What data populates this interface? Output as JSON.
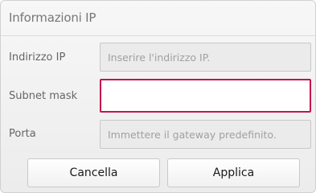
{
  "dialog": {
    "title": "Informazioni IP"
  },
  "fields": [
    {
      "label": "Indirizzo IP",
      "value": "",
      "placeholder": "Inserire l'indirizzo IP."
    },
    {
      "label": "Subnet mask",
      "value": "",
      "placeholder": ""
    },
    {
      "label": "Porta",
      "value": "",
      "placeholder": "Immettere il gateway predefinito."
    }
  ],
  "buttons": {
    "cancel_label": "Cancella",
    "apply_label": "Applica"
  },
  "colors": {
    "focus_border": "#c4134d"
  }
}
